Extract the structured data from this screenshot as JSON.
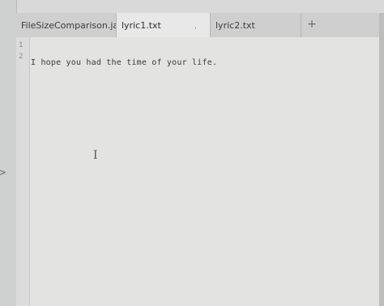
{
  "tabs": [
    {
      "label": "FileSizeComparison.ja...",
      "active": false
    },
    {
      "label": "lyric1.txt",
      "active": true,
      "modified_mark": "."
    },
    {
      "label": "lyric2.txt",
      "active": false
    }
  ],
  "new_tab_label": "+",
  "editor": {
    "lines": [
      {
        "number": "1",
        "text": "I hope you had the time of your life."
      },
      {
        "number": "2",
        "text": ""
      }
    ]
  },
  "icons": {
    "text_cursor": "I",
    "left_arrow": ">"
  }
}
